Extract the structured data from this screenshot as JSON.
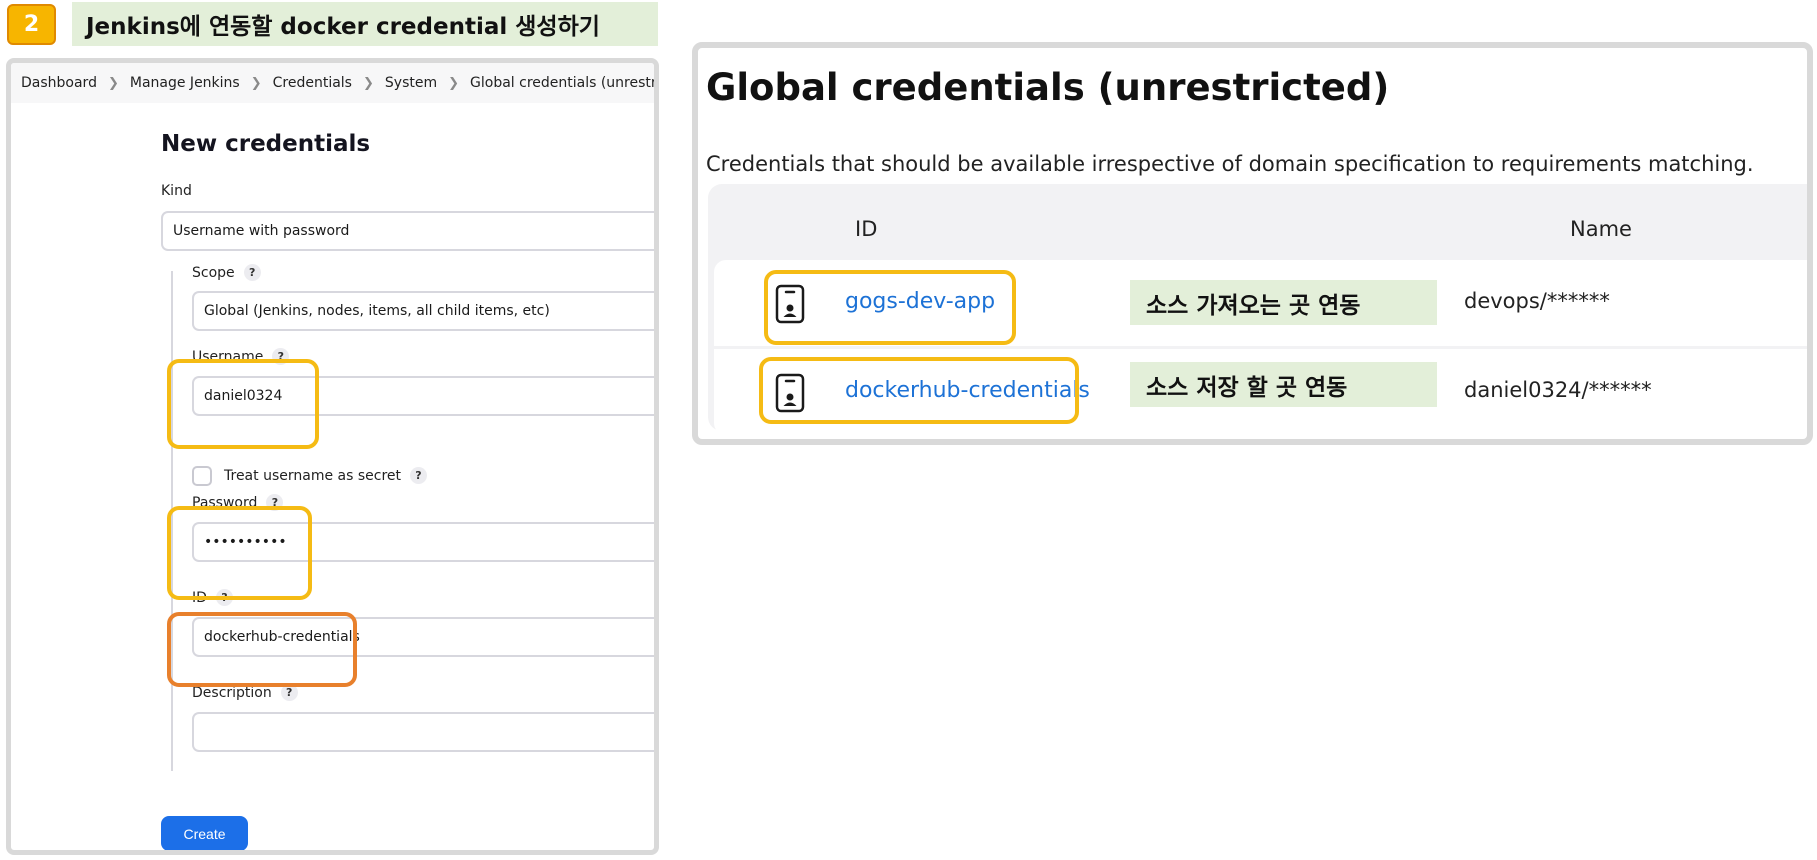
{
  "step": {
    "number": "2",
    "title": "Jenkins에 연동할 docker credential 생성하기"
  },
  "breadcrumb": [
    "Dashboard",
    "Manage Jenkins",
    "Credentials",
    "System",
    "Global credentials (unrestricted)"
  ],
  "form": {
    "title": "New credentials",
    "kind_label": "Kind",
    "kind_value": "Username with password",
    "scope_label": "Scope",
    "scope_value": "Global (Jenkins, nodes, items, all child items, etc)",
    "username_label": "Username",
    "username_value": "daniel0324",
    "treat_secret_label": "Treat username as secret",
    "password_label": "Password",
    "password_value": "••••••••••",
    "id_label": "ID",
    "id_value": "dockerhub-credentials",
    "description_label": "Description",
    "description_value": "",
    "help_glyph": "?",
    "create_label": "Create"
  },
  "credentials_page": {
    "title": "Global credentials (unrestricted)",
    "description": "Credentials that should be available irrespective of domain specification to requirements matching.",
    "columns": [
      "ID",
      "Name"
    ],
    "rows": [
      {
        "id": "gogs-dev-app",
        "name": "devops/******",
        "note": "소스 가져오는 곳 연동"
      },
      {
        "id": "dockerhub-credentials",
        "name": "daniel0324/******",
        "note": "소스 저장 할 곳 연동"
      }
    ]
  },
  "icons": {
    "breadcrumb_separator": "chevron-right-icon",
    "credential": "credential-card-icon"
  },
  "colors": {
    "highlight_yellow": "#f5bb14",
    "highlight_orange": "#e8802c",
    "step_badge": "#f7b500",
    "note_bg": "#e3efd9",
    "link_blue": "#1d72d6",
    "primary_button": "#1c6fe8"
  }
}
